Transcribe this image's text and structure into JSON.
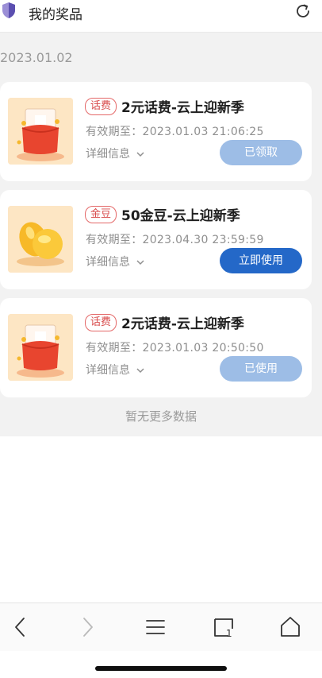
{
  "header": {
    "title": "我的奖品",
    "left_icon": "shield-icon",
    "right_icon": "refresh-icon"
  },
  "date_group": "2023.01.02",
  "prizes": [
    {
      "tag": "话费",
      "title": "2元话费-云上迎新季",
      "validity": "有效期至：2023.01.03 21:06:25",
      "detail_label": "详细信息",
      "action_label": "已领取",
      "status": "claimed",
      "thumb_icon": "phone-bill-gift-icon"
    },
    {
      "tag": "金豆",
      "title": "50金豆-云上迎新季",
      "validity": "有效期至：2023.04.30 23:59:59",
      "detail_label": "详细信息",
      "action_label": "立即使用",
      "status": "usable",
      "thumb_icon": "gold-beans-icon"
    },
    {
      "tag": "话费",
      "title": "2元话费-云上迎新季",
      "validity": "有效期至：2023.01.03 20:50:50",
      "detail_label": "详细信息",
      "action_label": "已使用",
      "status": "used",
      "thumb_icon": "phone-bill-gift-icon"
    }
  ],
  "footer_text": "暂无更多数据",
  "toolbar": {
    "back_icon": "back-arrow-icon",
    "forward_icon": "forward-arrow-icon",
    "menu_icon": "menu-icon",
    "tabs_icon": "tabs-icon",
    "tabs_count": "1",
    "home_icon": "home-icon"
  },
  "colors": {
    "primary": "#2468c8",
    "disabled": "#9dbde6",
    "tag_red": "#d84c4c",
    "background": "#f2f2f2"
  }
}
